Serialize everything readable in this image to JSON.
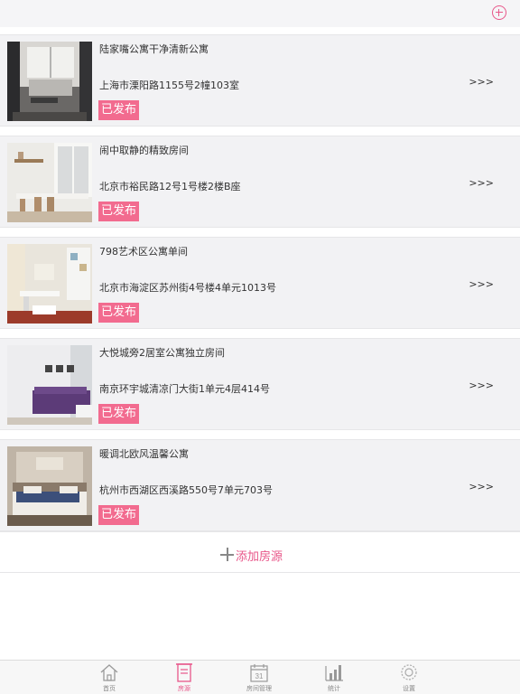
{
  "header": {
    "add_icon": "circle-plus-icon"
  },
  "listings": [
    {
      "title": "陆家嘴公寓干净清新公寓",
      "address": "上海市溧阳路1155号2幢103室",
      "status": "已发布",
      "arrow": ">>>"
    },
    {
      "title": "闹中取静的精致房间",
      "address": "北京市裕民路12号1号楼2楼B座",
      "status": "已发布",
      "arrow": ">>>"
    },
    {
      "title": "798艺术区公寓单间",
      "address": "北京市海淀区苏州街4号楼4单元1013号",
      "status": "已发布",
      "arrow": ">>>"
    },
    {
      "title": "大悦城旁2居室公寓独立房间",
      "address": "南京环宇城清凉门大街1单元4层414号",
      "status": "已发布",
      "arrow": ">>>"
    },
    {
      "title": "暖调北欧风温馨公寓",
      "address": "杭州市西湖区西溪路550号7单元703号",
      "status": "已发布",
      "arrow": ">>>"
    }
  ],
  "add_listing": {
    "label": "添加房源"
  },
  "colors": {
    "accent": "#e8578a",
    "badge": "#f26b8f"
  },
  "tabs": [
    {
      "label": "首页",
      "icon": "home-icon"
    },
    {
      "label": "房源",
      "icon": "building-icon",
      "active": true
    },
    {
      "label": "房间管理",
      "icon": "calendar-icon",
      "day": "31"
    },
    {
      "label": "统计",
      "icon": "bar-chart-icon"
    },
    {
      "label": "设置",
      "icon": "gear-icon"
    }
  ]
}
